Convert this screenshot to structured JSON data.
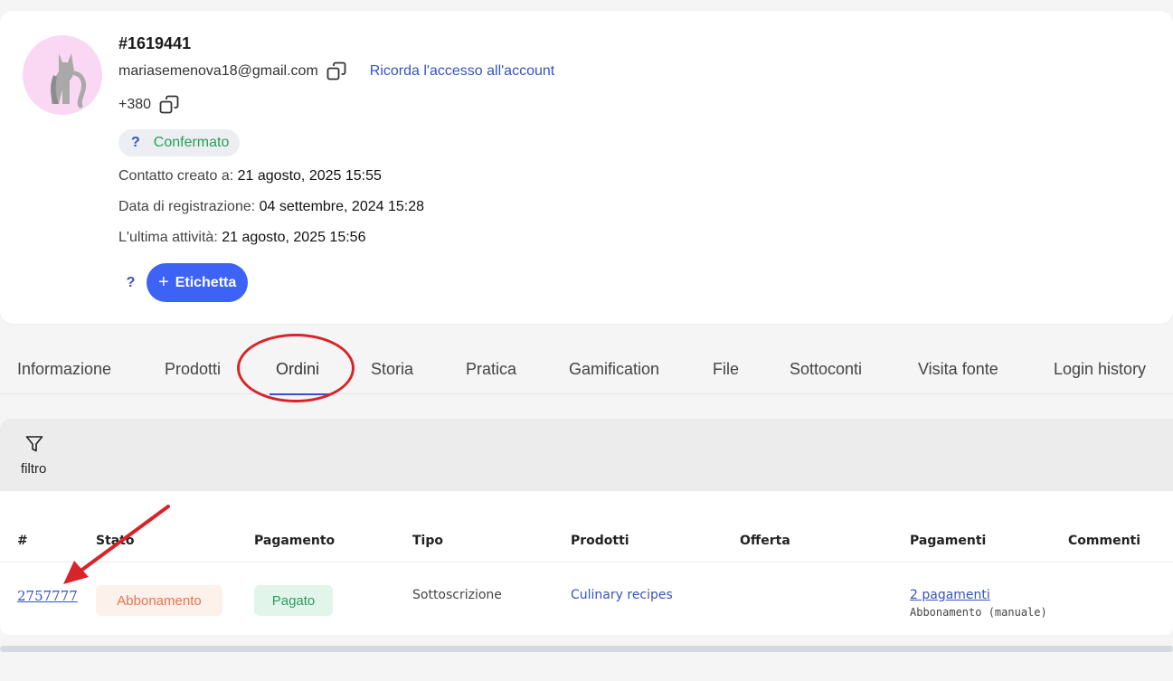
{
  "profile": {
    "id": "#1619441",
    "email": "mariasemenova18@gmail.com",
    "remember_link": "Ricorda l'accesso all'account",
    "phone": "+380",
    "status_icon": "?",
    "status": "Confermato",
    "contact_created_label": "Contatto creato a:",
    "contact_created_value": "21 agosto, 2025 15:55",
    "registration_label": "Data di registrazione:",
    "registration_value": "04 settembre, 2024 15:28",
    "last_activity_label": "L'ultima attività:",
    "last_activity_value": "21 agosto, 2025 15:56",
    "tag_help": "?",
    "tag_plus": "+",
    "tag_button": "Etichetta"
  },
  "tabs": [
    {
      "label": "Informazione"
    },
    {
      "label": "Prodotti"
    },
    {
      "label": "Ordini",
      "active": true
    },
    {
      "label": "Storia"
    },
    {
      "label": "Pratica"
    },
    {
      "label": "Gamification"
    },
    {
      "label": "File"
    },
    {
      "label": "Sottoconti"
    },
    {
      "label": "Visita fonte"
    },
    {
      "label": "Login history"
    }
  ],
  "filter": {
    "label": "filtro",
    "icon": "filter-icon"
  },
  "orders_table": {
    "headers": [
      "#",
      "Stato",
      "Pagamento",
      "Tipo",
      "Prodotti",
      "Offerta",
      "Pagamenti",
      "Commenti"
    ],
    "rows": [
      {
        "id": "2757777",
        "status": "Abbonamento",
        "payment": "Pagato",
        "type": "Sottoscrizione",
        "product": "Culinary recipes",
        "offer": "",
        "payments": "2 pagamenti",
        "payments_note": "Abbonamento (manuale)",
        "comments": ""
      }
    ]
  },
  "colors": {
    "accent": "#3d63f6",
    "link": "#3553c4",
    "success": "#2a9d5c",
    "warning": "#e8734a",
    "annotation": "#d8232a"
  }
}
